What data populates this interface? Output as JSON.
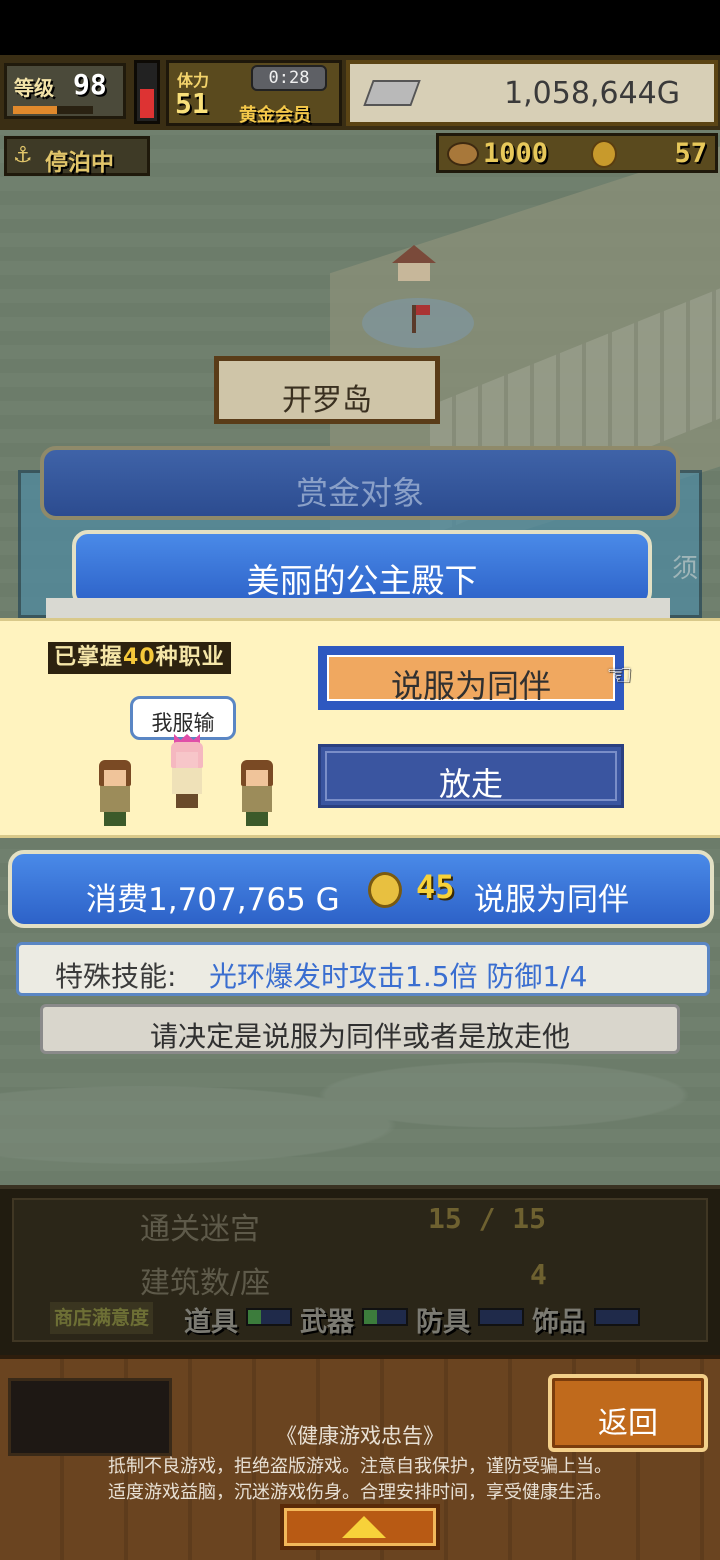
{
  "hud": {
    "level_label": "等级",
    "level_value": "98",
    "level_progress": 0.55,
    "stamina_level": 0.55,
    "member_small": "体力",
    "member_number": "51",
    "timer": "0:28",
    "member_title": "黄金会员",
    "money": "1,058,644G",
    "status": "停泊中",
    "medals": "1000",
    "coins": "57",
    "colors": {
      "hud_bg": "#3a2e14",
      "gold_text": "#f9e07a"
    }
  },
  "map": {
    "island_name": "开罗岛"
  },
  "bounty": {
    "header": "赏金对象",
    "target_name": "美丽的公主殿下",
    "side_glyph": "须"
  },
  "dialog": {
    "mastered_prefix": "已掌握",
    "mastered_count": "40",
    "mastered_suffix": "种职业",
    "speech": "我服输",
    "recruit_label": "说服为同伴",
    "release_label": "放走",
    "pointer_icon": "pointing-hand-icon"
  },
  "cost": {
    "text": "消费1,707,765 G",
    "gems": "45",
    "action": "说服为同伴"
  },
  "skill": {
    "label": "特殊技能:",
    "value": "光环爆发时攻击1.5倍 防御1/4"
  },
  "prompt": "请决定是说服为同伴或者是放走他",
  "stats": {
    "dungeons_label": "通关迷宫",
    "dungeons_value": "15 / 15",
    "buildings_label": "建筑数/座",
    "buildings_value": "4",
    "satisfaction_label": "商店满意度",
    "items": [
      {
        "name": "道具",
        "fill": 0.3
      },
      {
        "name": "武器",
        "fill": 0.3
      },
      {
        "name": "防具",
        "fill": 0.0
      },
      {
        "name": "饰品",
        "fill": 0.0
      }
    ]
  },
  "footer": {
    "back_label": "返回",
    "notice_title": "《健康游戏忠告》",
    "notice_line1": "抵制不良游戏，拒绝盗版游戏。注意自我保护，谨防受骗上当。",
    "notice_line2": "适度游戏益脑，沉迷游戏伤身。合理安排时间，享受健康生活。"
  }
}
